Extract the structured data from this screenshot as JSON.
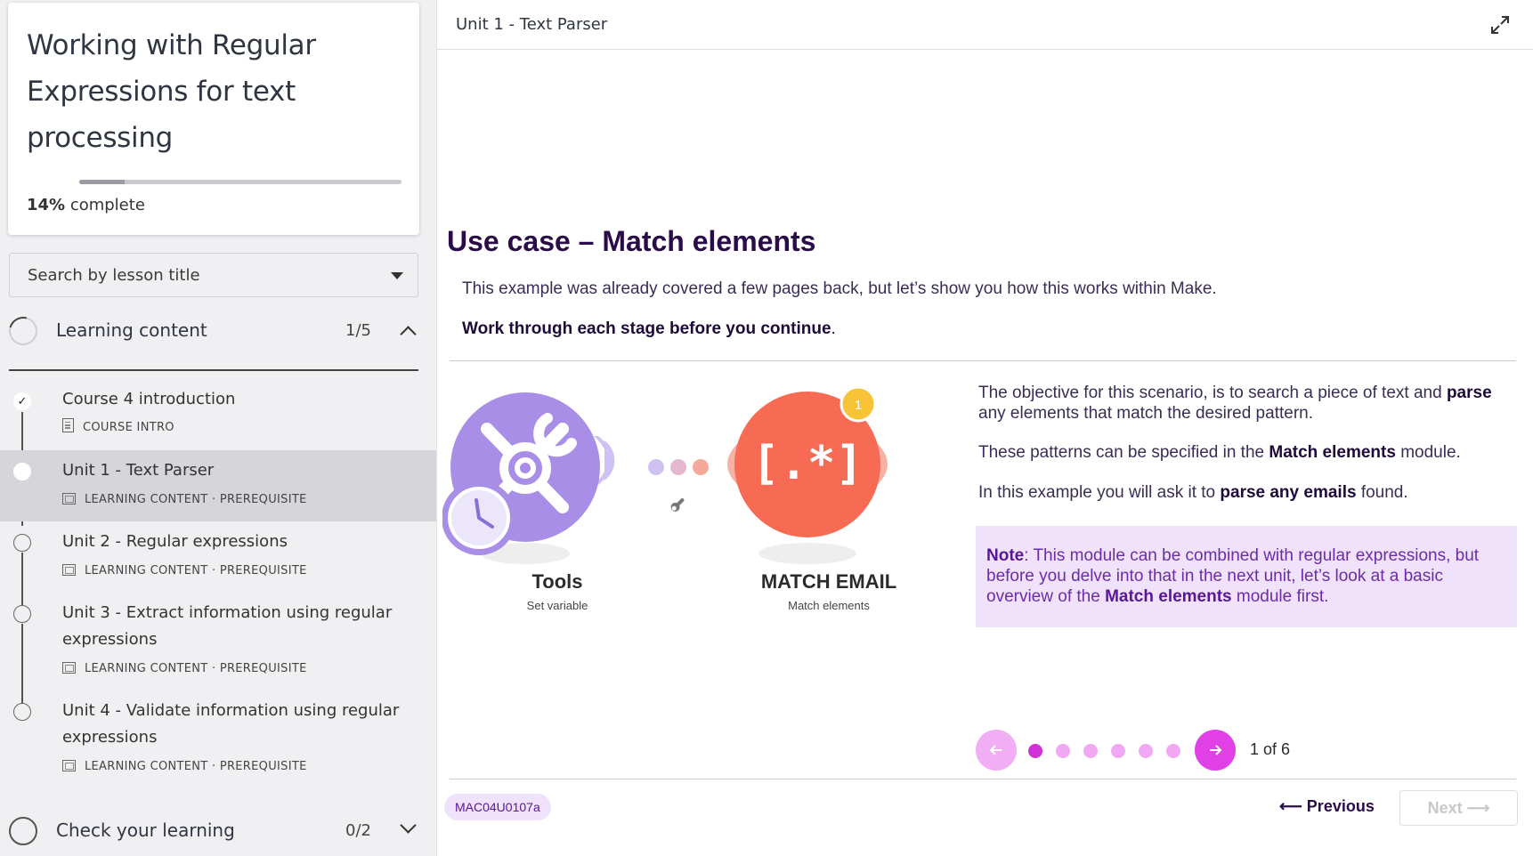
{
  "course": {
    "title": "Working with Regular Expressions for text processing",
    "progress_percent": 14,
    "progress_value": "14%",
    "progress_suffix": " complete"
  },
  "search": {
    "placeholder": "Search by lesson title"
  },
  "sections": [
    {
      "title": "Learning content",
      "count": "1/5",
      "expanded": true
    },
    {
      "title": "Check your learning",
      "count": "0/2",
      "expanded": false
    }
  ],
  "lessons": [
    {
      "title": "Course 4 introduction",
      "meta": "COURSE INTRO",
      "status": "done"
    },
    {
      "title": "Unit 1 - Text Parser",
      "meta": "LEARNING CONTENT · PREREQUISITE",
      "status": "active"
    },
    {
      "title": "Unit 2 - Regular expressions",
      "meta": "LEARNING CONTENT · PREREQUISITE",
      "status": "todo"
    },
    {
      "title": "Unit 3 - Extract information using regular expressions",
      "meta": "LEARNING CONTENT · PREREQUISITE",
      "status": "todo"
    },
    {
      "title": "Unit 4 - Validate information using regular expressions",
      "meta": "LEARNING CONTENT · PREREQUISITE",
      "status": "todo"
    }
  ],
  "main": {
    "unit_title": "Unit 1 - Text Parser",
    "heading": "Use case – Match elements",
    "intro": "This example was already covered a few pages back, but let’s show you how this works within Make.",
    "instruction_bold": "Work through each stage before you continue",
    "instruction_end": ".",
    "diagram": {
      "tools_label": "Tools",
      "tools_sub": "Set variable",
      "match_label": "MATCH EMAIL",
      "match_sub": "Match elements",
      "badge": "1",
      "match_glyph": "[.*]"
    },
    "desc": {
      "p1_a": "The objective for this scenario, is to search a piece of text and ",
      "p1_b": "parse",
      "p1_c": " any elements that match the desired pattern.",
      "p2_a": "These patterns can be specified in the ",
      "p2_b": "Match elements",
      "p2_c": " module.",
      "p3_a": "In this example you will ask it to ",
      "p3_b": "parse any emails",
      "p3_c": " found."
    },
    "note": {
      "label": "Note",
      "text_a": ": This module can be combined with regular expressions, but before you delve into that in the next unit, let’s look at a basic overview of the ",
      "text_b": "Match elements",
      "text_c": " module first."
    },
    "pager": {
      "current": 1,
      "total": 6,
      "label": "1 of 6"
    },
    "code": "MAC04U0107a",
    "prev_label": "⟵ Previous",
    "next_label": "Next ⟶"
  },
  "colors": {
    "accent": "#e040e6",
    "accent_light": "#f2aef5",
    "heading": "#2b0c4a",
    "note_bg": "#efe2fa",
    "tools_purple": "#a98ee8",
    "match_orange": "#f76b54",
    "badge_yellow": "#f7c438"
  },
  "icons": {
    "expand": "expand-arrows-icon",
    "prev": "arrow-left-icon",
    "next": "arrow-right-icon",
    "check": "checkmark-icon",
    "wrench": "wrench-icon"
  }
}
